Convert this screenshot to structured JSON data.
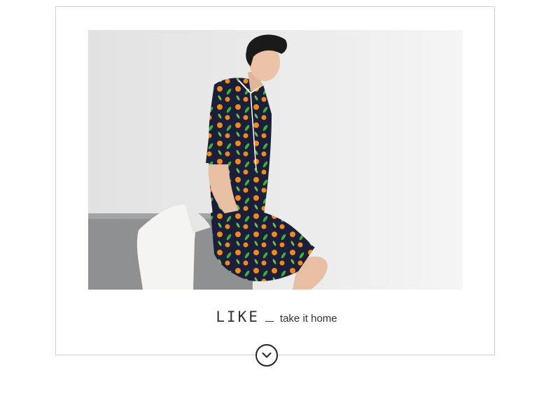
{
  "caption": {
    "title": "LIKE",
    "tagline": "take it home"
  },
  "icons": {
    "scroll": "chevron-down-icon"
  },
  "colors": {
    "border": "#cfcfcf",
    "text": "#333333",
    "pajama": "#1b1f3a",
    "accent_orange": "#f08a1e",
    "accent_green": "#3fae3a"
  }
}
